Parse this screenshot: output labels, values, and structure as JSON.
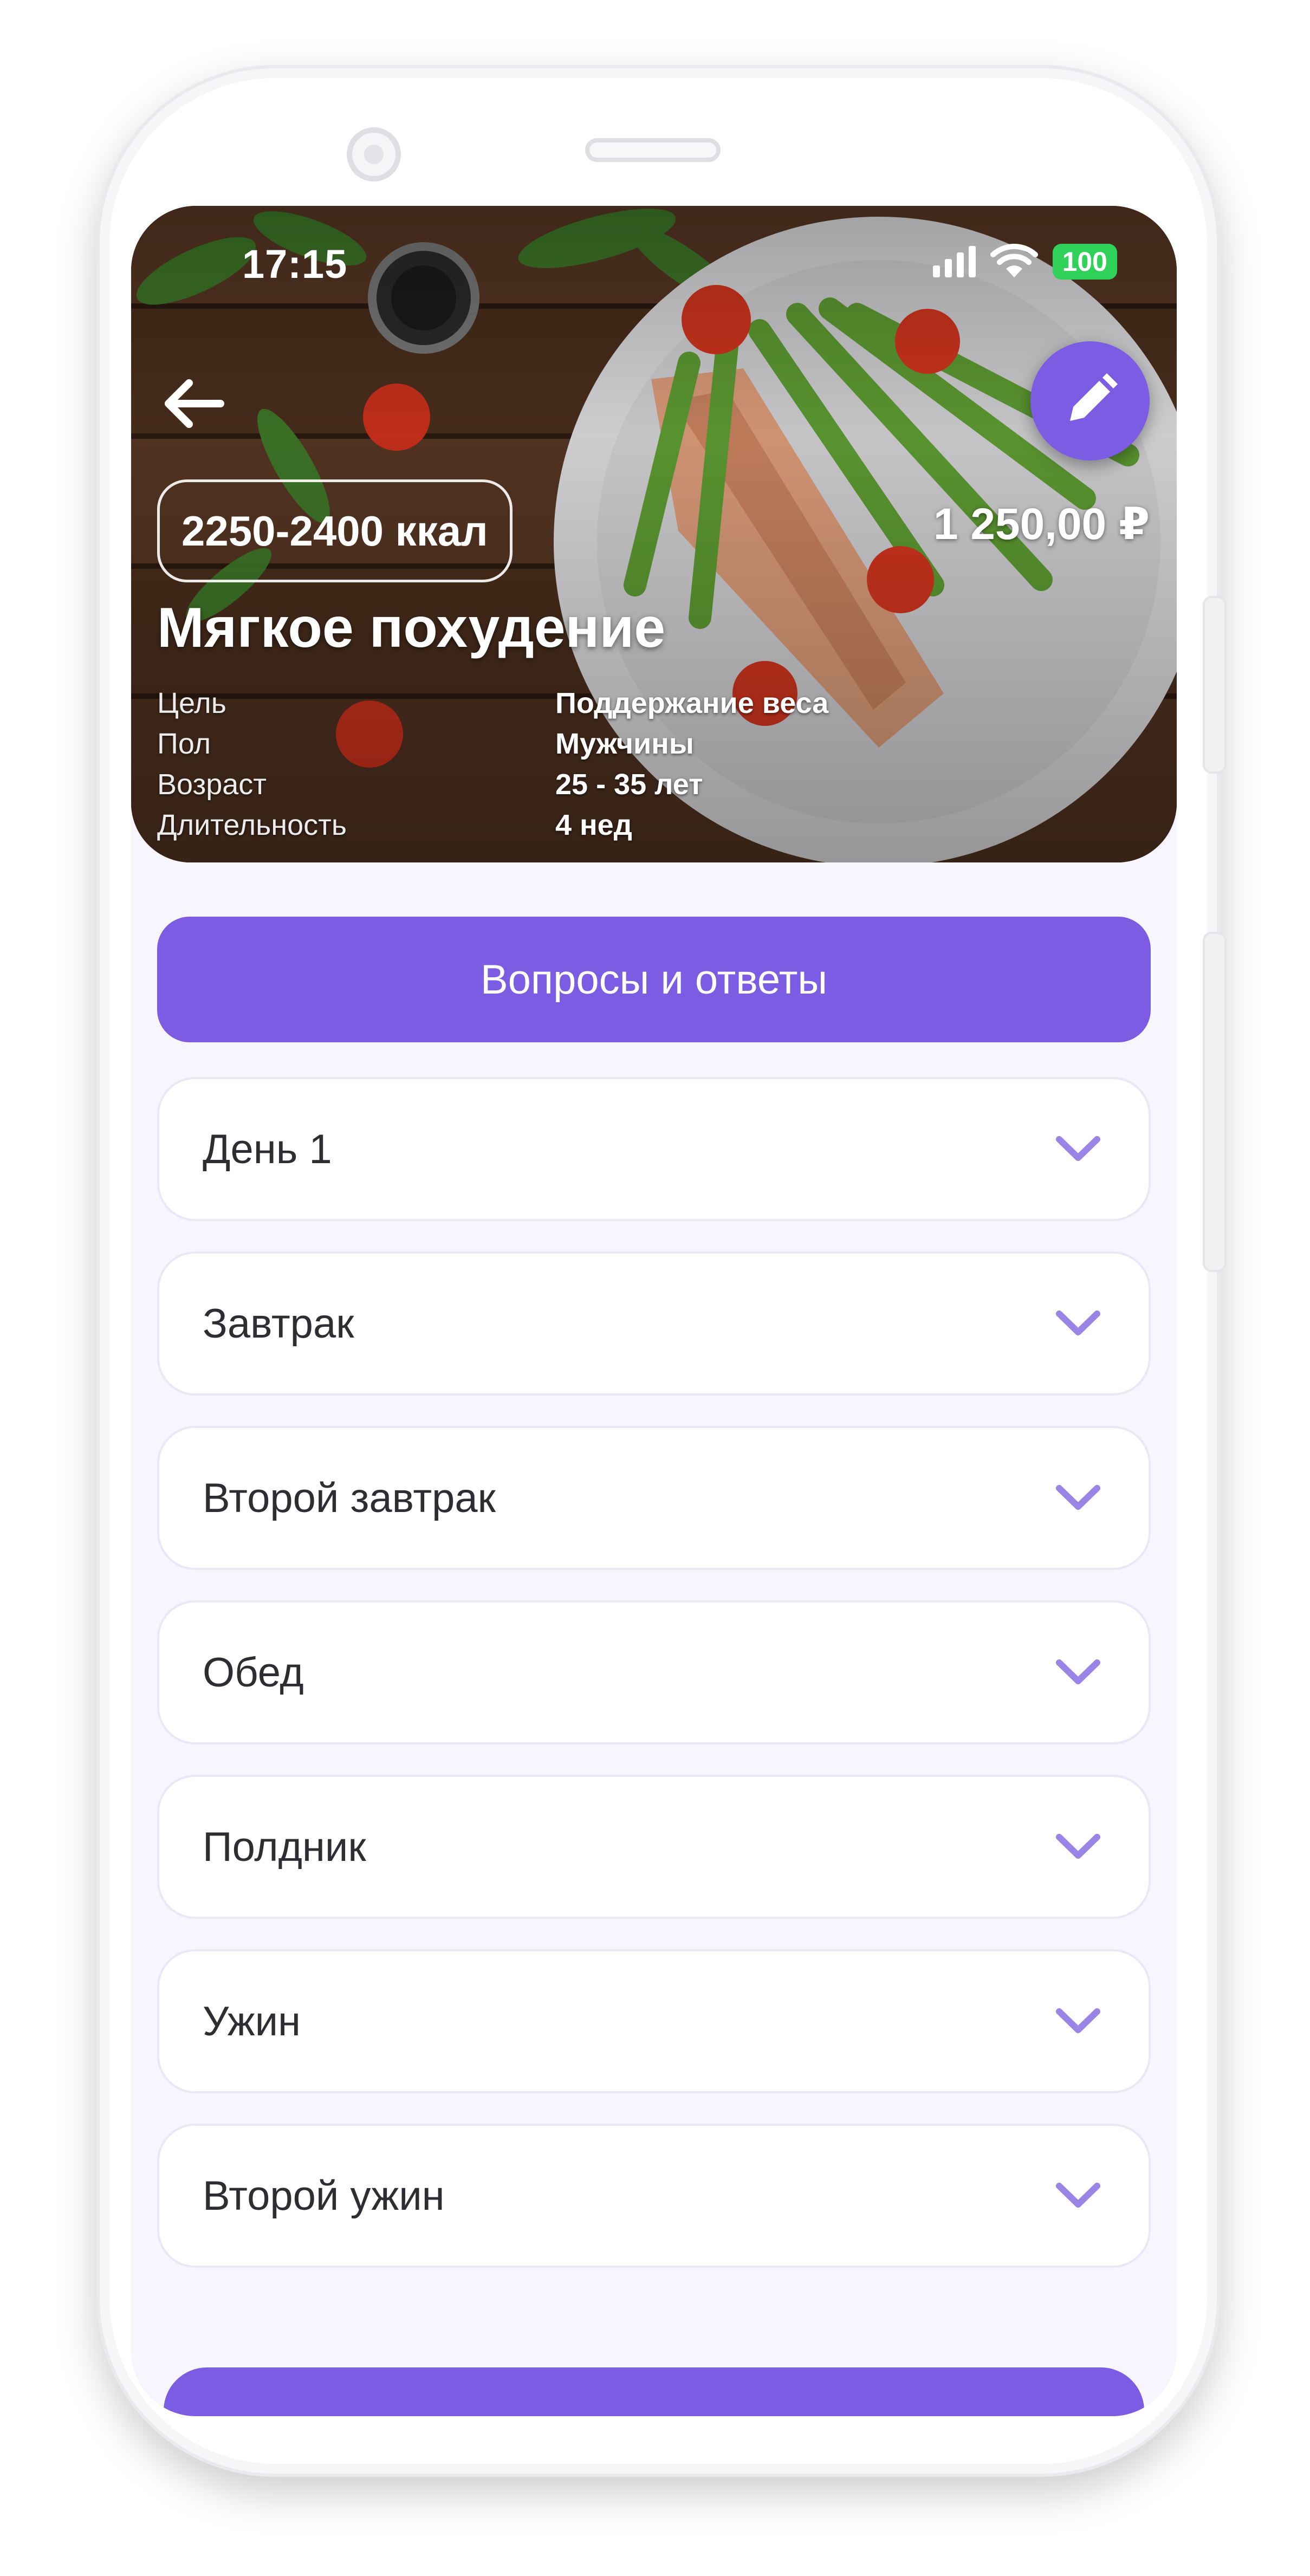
{
  "colors": {
    "accent": "#7c5ce3",
    "card_bg": "#ffffff",
    "screen_bg": "#f7f5fd",
    "battery": "#2fd158",
    "chevron": "#9a84e6"
  },
  "status_bar": {
    "time": "17:15",
    "battery_level": "100"
  },
  "header": {
    "back_icon": "arrow-left-icon",
    "edit_icon": "pencil-icon",
    "calories": "2250-2400 ккал",
    "price": "1 250,00 ₽",
    "title": "Мягкое похудение",
    "details": [
      {
        "label": "Цель",
        "value": "Поддержание веса"
      },
      {
        "label": "Пол",
        "value": "Мужчины"
      },
      {
        "label": "Возраст",
        "value": "25 - 35 лет"
      },
      {
        "label": "Длительность",
        "value": "4 нед"
      }
    ]
  },
  "qa_button": {
    "label": "Вопросы и ответы"
  },
  "accordion": [
    {
      "label": "День 1"
    },
    {
      "label": "Завтрак"
    },
    {
      "label": "Второй завтрак"
    },
    {
      "label": "Обед"
    },
    {
      "label": "Полдник"
    },
    {
      "label": "Ужин"
    },
    {
      "label": "Второй ужин"
    }
  ]
}
